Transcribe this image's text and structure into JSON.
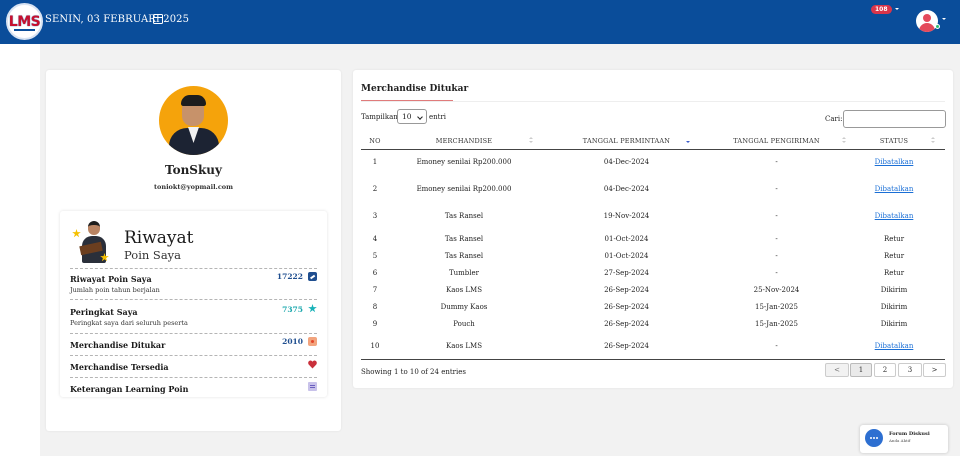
{
  "header": {
    "logo_text": "LMS",
    "date": "SENIN, 03 FEBRUARI 2025",
    "notification_count": "108",
    "brand_color": "#0a4d9a"
  },
  "profile": {
    "name": "TonSkuy",
    "email": "toniokt@yopmail.com",
    "riwayat_title": "Riwayat",
    "riwayat_subtitle": "Poin Saya",
    "items": [
      {
        "title": "Riwayat Poin Saya",
        "subtitle": "Jumlah poin tahun berjalan",
        "value": "17222",
        "value_color": "#1f4e8f",
        "icon": "chart-icon"
      },
      {
        "title": "Peringkat Saya",
        "subtitle": "Peringkat saya dari seluruh peserta",
        "value": "7375",
        "value_color": "#19a7ad",
        "icon": "star-icon"
      },
      {
        "title": "Merchandise Ditukar",
        "subtitle": "",
        "value": "2010",
        "value_color": "#1f4e8f",
        "icon": "merchandise-icon"
      },
      {
        "title": "Merchandise Tersedia",
        "subtitle": "",
        "value": "",
        "value_color": "#c9303b",
        "icon": "heart-icon"
      },
      {
        "title": "Keterangan Learning Poin",
        "subtitle": "",
        "value": "",
        "value_color": "#6b5fbf",
        "icon": "document-icon"
      }
    ]
  },
  "merch": {
    "title": "Merchandise Ditukar",
    "show_label": "Tampilkan",
    "entries_value": "10",
    "entries_label": "entri",
    "search_label": "Cari:",
    "search_value": "",
    "columns": [
      "NO",
      "MERCHANDISE",
      "TANGGAL PERMINTAAN",
      "TANGGAL PENGIRIMAN",
      "STATUS"
    ],
    "rows": [
      {
        "no": "1",
        "item": "Emoney senilai Rp200.000",
        "requested": "04-Dec-2024",
        "shipped": "-",
        "status": "Dibatalkan",
        "link": true
      },
      {
        "no": "2",
        "item": "Emoney senilai Rp200.000",
        "requested": "04-Dec-2024",
        "shipped": "-",
        "status": "Dibatalkan",
        "link": true
      },
      {
        "no": "3",
        "item": "Tas Ransel",
        "requested": "19-Nov-2024",
        "shipped": "-",
        "status": "Dibatalkan",
        "link": true
      },
      {
        "no": "4",
        "item": "Tas Ransel",
        "requested": "01-Oct-2024",
        "shipped": "-",
        "status": "Retur",
        "link": false
      },
      {
        "no": "5",
        "item": "Tas Ransel",
        "requested": "01-Oct-2024",
        "shipped": "-",
        "status": "Retur",
        "link": false
      },
      {
        "no": "6",
        "item": "Tumbler",
        "requested": "27-Sep-2024",
        "shipped": "-",
        "status": "Retur",
        "link": false
      },
      {
        "no": "7",
        "item": "Kaos LMS",
        "requested": "26-Sep-2024",
        "shipped": "25-Nov-2024",
        "status": "Dikirim",
        "link": false
      },
      {
        "no": "8",
        "item": "Dummy Kaos",
        "requested": "26-Sep-2024",
        "shipped": "15-Jan-2025",
        "status": "Dikirim",
        "link": false
      },
      {
        "no": "9",
        "item": "Pouch",
        "requested": "26-Sep-2024",
        "shipped": "15-Jan-2025",
        "status": "Dikirim",
        "link": false
      },
      {
        "no": "10",
        "item": "Kaos LMS",
        "requested": "26-Sep-2024",
        "shipped": "-",
        "status": "Dibatalkan",
        "link": true
      }
    ],
    "info": "Showing 1 to 10 of 24 entries",
    "pagination": {
      "prev": "<",
      "pages": [
        "1",
        "2",
        "3"
      ],
      "next": ">",
      "current": "1"
    }
  },
  "forum": {
    "title": "Forum Diskusi",
    "subtitle": "Anda Aktif"
  }
}
